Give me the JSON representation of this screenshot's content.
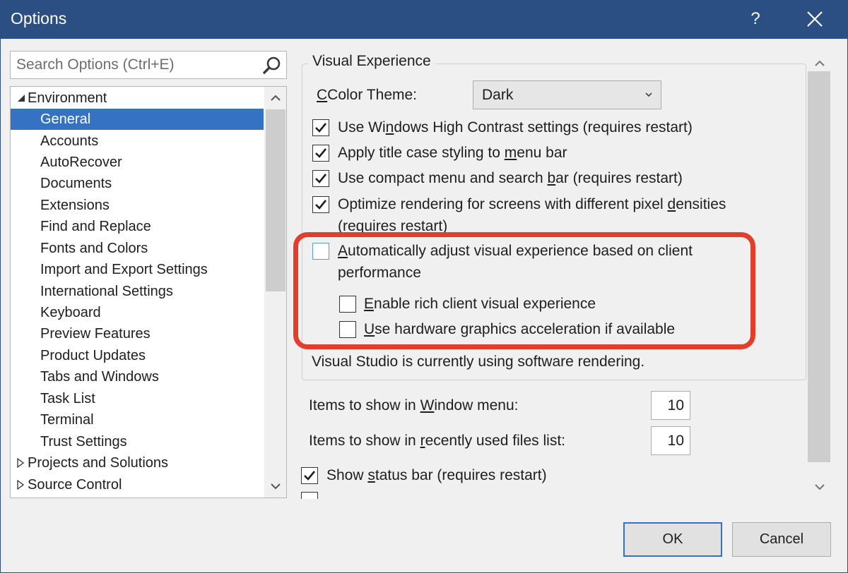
{
  "window": {
    "title": "Options"
  },
  "search": {
    "placeholder": "Search Options (Ctrl+E)"
  },
  "tree": {
    "root": "Environment",
    "children": [
      "General",
      "Accounts",
      "AutoRecover",
      "Documents",
      "Extensions",
      "Find and Replace",
      "Fonts and Colors",
      "Import and Export Settings",
      "International Settings",
      "Keyboard",
      "Preview Features",
      "Product Updates",
      "Tabs and Windows",
      "Task List",
      "Terminal",
      "Trust Settings"
    ],
    "collapsed": [
      "Projects and Solutions",
      "Source Control"
    ],
    "selected": "General"
  },
  "visual_experience": {
    "group_title": "Visual Experience",
    "color_theme_label": "Color Theme:",
    "color_theme_value": "Dark",
    "checkbox_high_contrast": {
      "label_pre": "Use Wi",
      "label_key": "n",
      "label_post": "dows High Contrast settings (requires restart)",
      "checked": true
    },
    "checkbox_title_case": {
      "label_pre": "Apply title case styling to ",
      "label_key": "m",
      "label_post": "enu bar",
      "checked": true
    },
    "checkbox_compact_menu": {
      "label_pre": "Use compact menu and search ",
      "label_key": "b",
      "label_post": "ar (requires restart)",
      "checked": true
    },
    "checkbox_optimize_rendering": {
      "label_pre": "Optimize rendering for screens with different pixel ",
      "label_key": "d",
      "label_post": "ensities",
      "label_line2": "(requires restart)",
      "checked": true
    },
    "checkbox_auto_adjust": {
      "label_key": "A",
      "label_post": "utomatically adjust visual experience based on client",
      "label_line2": "performance",
      "checked": false
    },
    "checkbox_rich_client": {
      "label_key": "E",
      "label_post": "nable rich client visual experience",
      "checked": false
    },
    "checkbox_hw_accel": {
      "label_key": "U",
      "label_post": "se hardware graphics acceleration if available",
      "checked": false
    },
    "status_text": "Visual Studio is currently using software rendering."
  },
  "window_menu_items": {
    "label_pre": "Items to show in ",
    "label_key": "W",
    "label_post": "indow menu:",
    "value": "10"
  },
  "recent_files": {
    "label_pre": "Items to show in ",
    "label_key": "r",
    "label_post": "ecently used files list:",
    "value": "10"
  },
  "status_bar": {
    "label_pre": "Show ",
    "label_key": "s",
    "label_post": "tatus bar (requires restart)",
    "checked": true
  },
  "buttons": {
    "ok": "OK",
    "cancel": "Cancel"
  },
  "colors": {
    "titlebar": "#2b4e83",
    "selection": "#3572c4",
    "highlight_border": "#e33d2c"
  }
}
